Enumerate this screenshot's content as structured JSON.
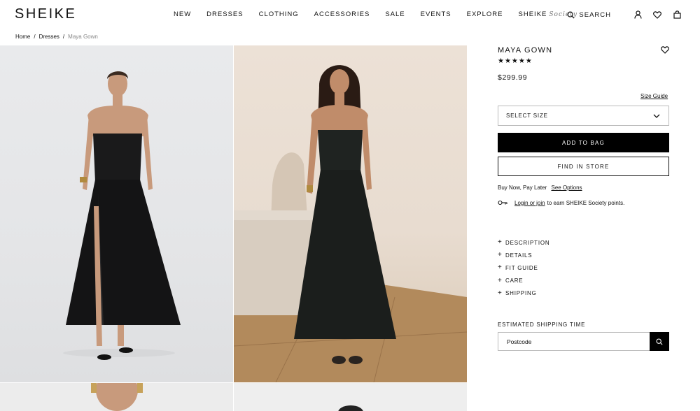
{
  "brand": {
    "logo": "SHEIKE"
  },
  "nav": {
    "items": [
      "NEW",
      "DRESSES",
      "CLOTHING",
      "ACCESSORIES",
      "SALE",
      "EVENTS",
      "EXPLORE"
    ],
    "society_label": "SHEIKE",
    "society_script": "Society"
  },
  "header": {
    "search_label": "SEARCH",
    "icons": [
      "search-icon",
      "account-icon",
      "heart-icon",
      "bag-icon"
    ]
  },
  "breadcrumb": {
    "home": "Home",
    "sep": "/",
    "category": "Dresses",
    "current": "Maya Gown"
  },
  "product": {
    "title": "MAYA GOWN",
    "rating": 5,
    "stars": "★★★★★",
    "price": "$299.99",
    "size_guide": "Size Guide",
    "select_size": "SELECT SIZE",
    "add_to_bag": "ADD TO BAG",
    "find_in_store": "FIND IN STORE",
    "bnpl_text": "Buy Now, Pay Later",
    "bnpl_link": "See Options",
    "login_link": "Login or join",
    "login_text": "to earn SHEIKE Society points.",
    "accordion": [
      "DESCRIPTION",
      "DETAILS",
      "FIT GUIDE",
      "CARE",
      "SHIPPING"
    ],
    "shipping_label": "ESTIMATED SHIPPING TIME",
    "postcode_placeholder": "Postcode"
  },
  "colors": {
    "accent": "#000000",
    "border": "#bbbbbb",
    "muted": "#888888"
  }
}
